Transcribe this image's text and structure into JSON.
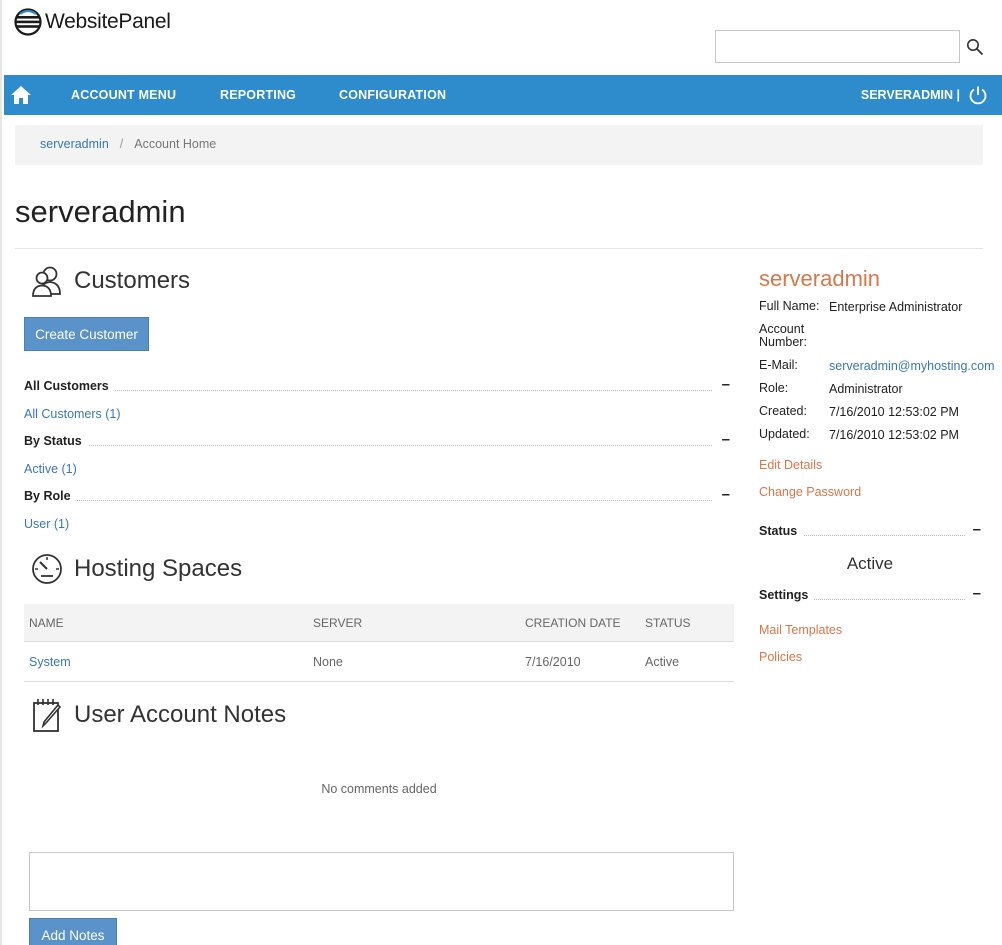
{
  "header": {
    "logo_text": "WebsitePanel",
    "search": {
      "value": "",
      "placeholder": ""
    }
  },
  "nav": {
    "items": [
      {
        "label": "ACCOUNT MENU"
      },
      {
        "label": "REPORTING"
      },
      {
        "label": "CONFIGURATION"
      }
    ],
    "user_label": "SERVERADMIN |"
  },
  "breadcrumb": {
    "link": "serveradmin",
    "separator": "/",
    "current": "Account Home"
  },
  "page": {
    "title": "serveradmin"
  },
  "customers": {
    "title": "Customers",
    "create_button": "Create Customer",
    "groups": [
      {
        "title": "All Customers",
        "toggle": "–",
        "link": "All Customers (1)"
      },
      {
        "title": "By Status",
        "toggle": "–",
        "link": "Active (1)"
      },
      {
        "title": "By Role",
        "toggle": "–",
        "link": "User (1)"
      }
    ]
  },
  "hosting": {
    "title": "Hosting Spaces",
    "columns": [
      "NAME",
      "SERVER",
      "CREATION DATE",
      "STATUS"
    ],
    "rows": [
      {
        "name": "System",
        "server": "None",
        "creation_date": "7/16/2010",
        "status": "Active"
      }
    ]
  },
  "notes": {
    "title": "User Account Notes",
    "empty_text": "No comments added",
    "input_value": "",
    "add_button": "Add Notes"
  },
  "account": {
    "title": "serveradmin",
    "full_name_label": "Full Name:",
    "full_name": "Enterprise Administrator",
    "account_number_label_1": "Account",
    "account_number_label_2": "Number:",
    "account_number": "",
    "email_label": "E-Mail:",
    "email": "serveradmin@myhosting.com",
    "role_label": "Role:",
    "role": "Administrator",
    "created_label": "Created:",
    "created": "7/16/2010 12:53:02 PM",
    "updated_label": "Updated:",
    "updated": "7/16/2010 12:53:02 PM",
    "edit_details": "Edit Details",
    "change_password": "Change Password",
    "status_title": "Status",
    "status_toggle": "–",
    "status_value": "Active",
    "settings_title": "Settings",
    "settings_toggle": "–",
    "settings_links": [
      "Mail Templates",
      "Policies"
    ]
  },
  "colors": {
    "nav_bar": "#2e8bcc",
    "link": "#3a78b4",
    "accent_orange": "#d9774a",
    "button": "#5a93c9"
  }
}
